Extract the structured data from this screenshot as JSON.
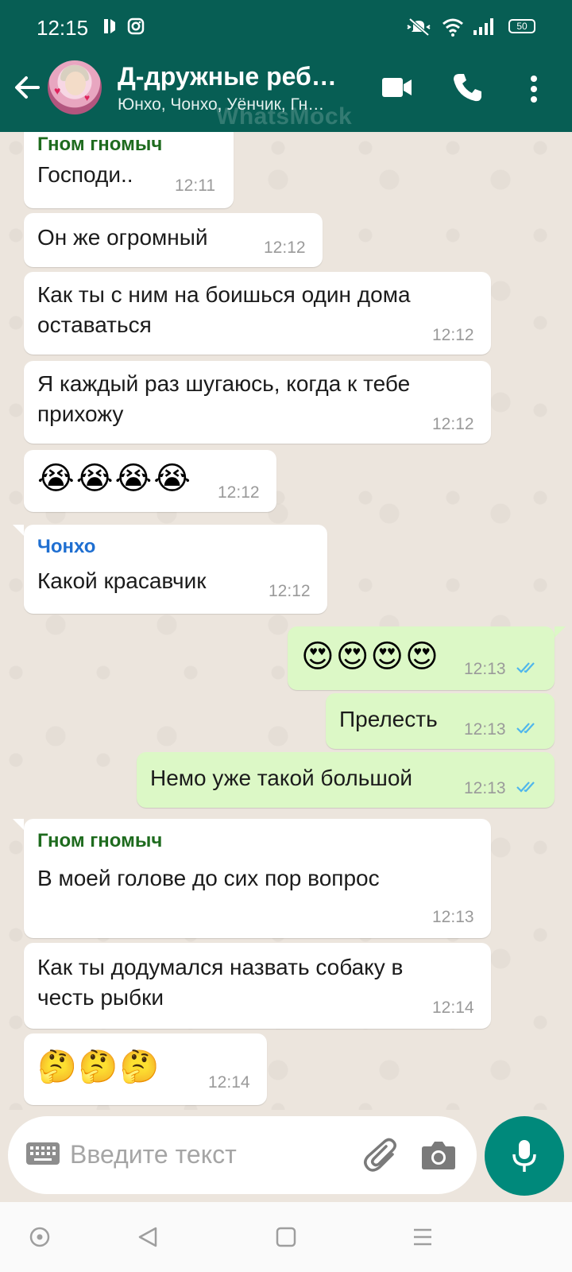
{
  "status_bar": {
    "time": "12:15",
    "battery": "50"
  },
  "header": {
    "title": "Д-дружные реб…",
    "subtitle": "Юнхо, Чонхо, Уёнчик, Гн…",
    "watermark": "WhatsMock"
  },
  "colors": {
    "header_bg": "#075e54",
    "incoming_bubble": "#ffffff",
    "outgoing_bubble": "#dcf8c6",
    "sender_green": "#1e6b1e",
    "sender_blue": "#1f6fd1",
    "read_ticks": "#4fb6ec",
    "mic_button": "#00897b"
  },
  "messages": [
    {
      "sender": "Гном гномыч",
      "text": "Господи..",
      "time": "12:11",
      "direction": "in"
    },
    {
      "text": "Он же огромный",
      "time": "12:12",
      "direction": "in"
    },
    {
      "lines": [
        "Как ты с ним на боишься один дома",
        "оставаться"
      ],
      "time": "12:12",
      "direction": "in"
    },
    {
      "lines": [
        "Я каждый раз шугаюсь, когда к тебе",
        "прихожу"
      ],
      "time": "12:12",
      "direction": "in"
    },
    {
      "emoji": "😭😭😭😭",
      "time": "12:12",
      "direction": "in"
    },
    {
      "sender": "Чонхо",
      "text": "Какой красавчик",
      "time": "12:12",
      "direction": "in"
    },
    {
      "emoji": "😍😍😍😍",
      "time": "12:13",
      "direction": "out",
      "status": "read"
    },
    {
      "text": "Прелесть",
      "time": "12:13",
      "direction": "out",
      "status": "read"
    },
    {
      "text": "Немо уже такой большой",
      "time": "12:13",
      "direction": "out",
      "status": "read"
    },
    {
      "sender": "Гном гномыч",
      "text": "В моей голове до сих пор вопрос",
      "time": "12:13",
      "direction": "in"
    },
    {
      "lines": [
        "Как ты додумался назвать собаку в",
        "честь рыбки"
      ],
      "time": "12:14",
      "direction": "in"
    },
    {
      "emoji": "🤔🤔🤔",
      "time": "12:14",
      "direction": "in"
    }
  ],
  "composer": {
    "placeholder": "Введите текст",
    "icons": [
      "keyboard-icon",
      "attach-icon",
      "camera-icon",
      "mic-icon"
    ]
  },
  "app_bar_icons": [
    "back-arrow-icon",
    "video-call-icon",
    "voice-call-icon",
    "more-vert-icon"
  ],
  "nav_bar_icons": [
    "nav-assist-icon",
    "nav-back-icon",
    "nav-home-icon",
    "nav-menu-icon"
  ]
}
